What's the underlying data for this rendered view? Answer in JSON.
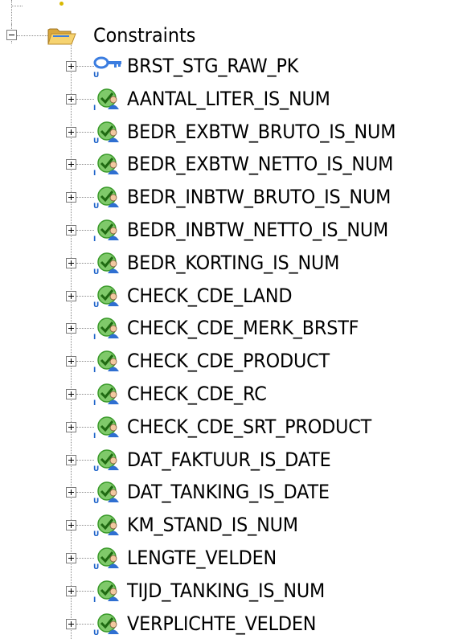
{
  "tree": {
    "folder": {
      "label": "Constraints",
      "icon": "folder-open-icon",
      "expanded": true
    },
    "items": [
      {
        "label": "BRST_STG_RAW_PK",
        "icon": "primary-key-icon",
        "badge": "U",
        "expanded": false
      },
      {
        "label": "AANTAL_LITER_IS_NUM",
        "icon": "check-constraint-icon",
        "badge": "I",
        "expanded": false
      },
      {
        "label": "BEDR_EXBTW_BRUTO_IS_NUM",
        "icon": "check-constraint-icon",
        "badge": "U",
        "expanded": false
      },
      {
        "label": "BEDR_EXBTW_NETTO_IS_NUM",
        "icon": "check-constraint-icon",
        "badge": "I",
        "expanded": false
      },
      {
        "label": "BEDR_INBTW_BRUTO_IS_NUM",
        "icon": "check-constraint-icon",
        "badge": "U",
        "expanded": false
      },
      {
        "label": "BEDR_INBTW_NETTO_IS_NUM",
        "icon": "check-constraint-icon",
        "badge": "I",
        "expanded": false
      },
      {
        "label": "BEDR_KORTING_IS_NUM",
        "icon": "check-constraint-icon",
        "badge": "U",
        "expanded": false
      },
      {
        "label": "CHECK_CDE_LAND",
        "icon": "check-constraint-icon",
        "badge": "U",
        "expanded": false
      },
      {
        "label": "CHECK_CDE_MERK_BRSTF",
        "icon": "check-constraint-icon",
        "badge": "I",
        "expanded": false
      },
      {
        "label": "CHECK_CDE_PRODUCT",
        "icon": "check-constraint-icon",
        "badge": "I",
        "expanded": false
      },
      {
        "label": "CHECK_CDE_RC",
        "icon": "check-constraint-icon",
        "badge": "I",
        "expanded": false
      },
      {
        "label": "CHECK_CDE_SRT_PRODUCT",
        "icon": "check-constraint-icon",
        "badge": "I",
        "expanded": false
      },
      {
        "label": "DAT_FAKTUUR_IS_DATE",
        "icon": "check-constraint-icon",
        "badge": "U",
        "expanded": false
      },
      {
        "label": "DAT_TANKING_IS_DATE",
        "icon": "check-constraint-icon",
        "badge": "U",
        "expanded": false
      },
      {
        "label": "KM_STAND_IS_NUM",
        "icon": "check-constraint-icon",
        "badge": "U",
        "expanded": false
      },
      {
        "label": "LENGTE_VELDEN",
        "icon": "check-constraint-icon",
        "badge": "U",
        "expanded": false
      },
      {
        "label": "TIJD_TANKING_IS_NUM",
        "icon": "check-constraint-icon",
        "badge": "I",
        "expanded": false
      },
      {
        "label": "VERPLICHTE_VELDEN",
        "icon": "check-constraint-icon",
        "badge": "U",
        "expanded": false
      }
    ]
  },
  "colors": {
    "folder": "#e8b84a",
    "folder_front": "#f7d57a",
    "key": "#3b7de0",
    "check_green": "#3a9a2a",
    "check_person": "#2f6fd1",
    "badge_u": "#1c62c9",
    "badge_i": "#1c62c9"
  }
}
